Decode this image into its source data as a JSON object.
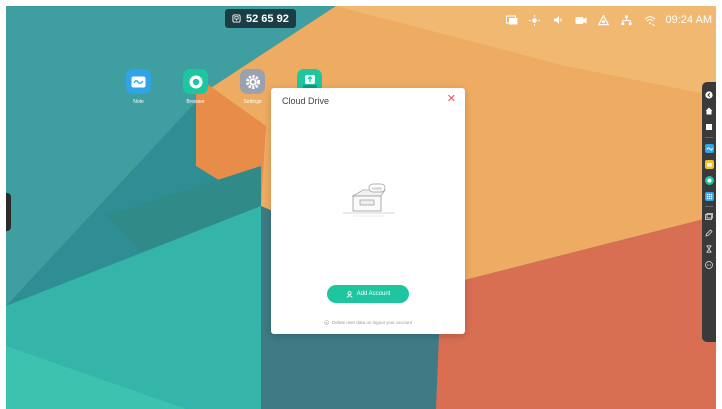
{
  "topbar": {
    "room_code": "52 65 92",
    "clock": "09:24 AM",
    "icons": [
      "screen-share-icon",
      "brightness-icon",
      "volume-icon",
      "camera-icon",
      "home-signal-icon",
      "network-icon",
      "wifi-icon"
    ]
  },
  "desktop": {
    "apps": [
      {
        "label": "Note",
        "icon": "note-icon",
        "color": "#2fa5e8"
      },
      {
        "label": "Browser",
        "icon": "browser-icon",
        "color": "#1ec6a0"
      },
      {
        "label": "Settings",
        "icon": "settings-icon",
        "color": "#9aa3ad"
      },
      {
        "label": "",
        "icon": "usb-icon",
        "color": "#1ec6a0"
      }
    ]
  },
  "dialog": {
    "title": "Cloud Drive",
    "empty_label": "empty",
    "add_button": "Add Account",
    "footer_note": "Delete user data on logout your account"
  },
  "colors": {
    "accent": "#1ec6a0",
    "close": "#e8565a",
    "toolbar": "#3a3a3a"
  }
}
